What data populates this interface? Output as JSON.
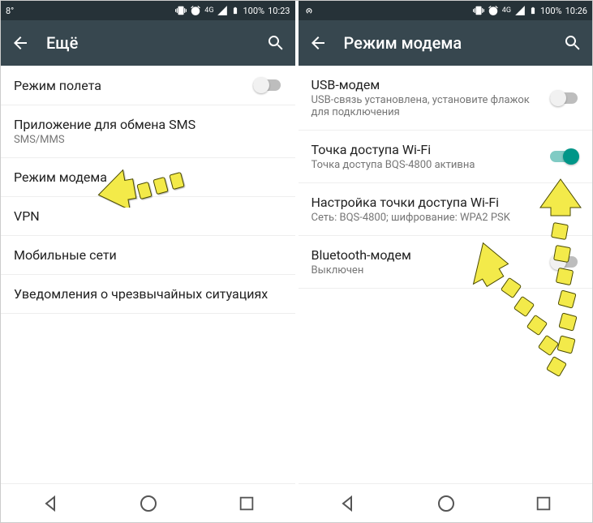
{
  "left": {
    "status": {
      "temp": "8°",
      "network": "4G",
      "battery": "100%",
      "time": "10:23"
    },
    "toolbar": {
      "title": "Ещё"
    },
    "items": [
      {
        "title": "Режим полета",
        "sub": "",
        "toggle": false,
        "toggleOn": false
      },
      {
        "title": "Приложение для обмена SMS",
        "sub": "SMS/MMS",
        "toggle": null
      },
      {
        "title": "Режим модема",
        "sub": "",
        "toggle": null
      },
      {
        "title": "VPN",
        "sub": "",
        "toggle": null
      },
      {
        "title": "Мобильные сети",
        "sub": "",
        "toggle": null
      },
      {
        "title": "Уведомления о чрезвычайных ситуациях",
        "sub": "",
        "toggle": null
      }
    ]
  },
  "right": {
    "status": {
      "temp": "",
      "network": "4G",
      "battery": "100%",
      "time": "10:26"
    },
    "toolbar": {
      "title": "Режим модема"
    },
    "items": [
      {
        "title": "USB-модем",
        "sub": "USB-связь установлена, установите флажок для подключения",
        "toggle": false
      },
      {
        "title": "Точка доступа Wi-Fi",
        "sub": "Точка доступа BQS-4800 активна",
        "toggle": true
      },
      {
        "title": "Настройка точки доступа Wi-Fi",
        "sub": "Сеть: BQS-4800; шифрование: WPA2 PSK",
        "toggle": null
      },
      {
        "title": "Bluetooth-модем",
        "sub": "Выключен",
        "toggle": false
      }
    ]
  }
}
